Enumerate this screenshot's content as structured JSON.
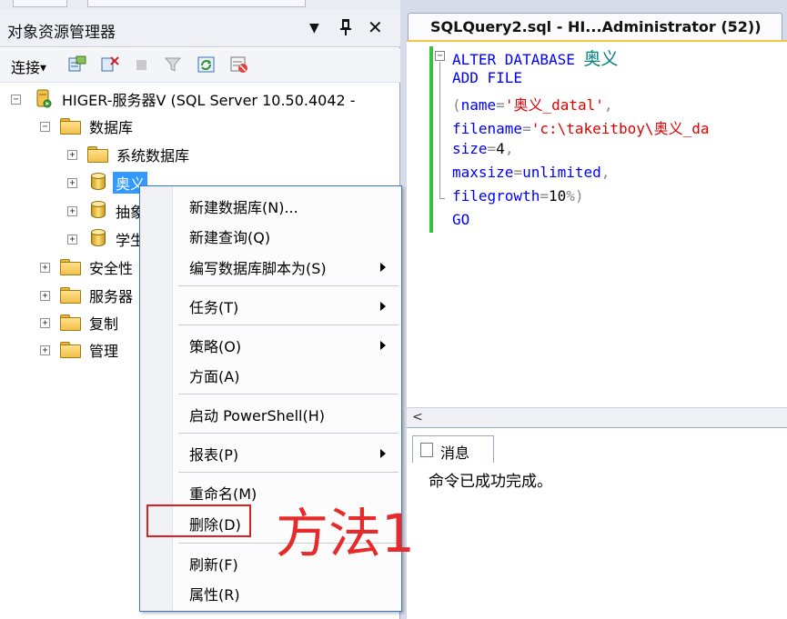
{
  "object_explorer": {
    "title": "对象资源管理器",
    "dropdown_glyph": "▼",
    "pin_glyph": "📌",
    "close_glyph": "✕",
    "connect_label": "连接",
    "tree": {
      "server": "HIGER-服务器V (SQL Server 10.50.4042 -",
      "databases": "数据库",
      "system_databases": "系统数据库",
      "db_aoyi": "奥义",
      "db_2": "抽象",
      "db_3": "学生",
      "security": "安全性",
      "server_objects": "服务器",
      "replication": "复制",
      "management": "管理"
    }
  },
  "editor": {
    "tab_title": "SQLQuery2.sql - HI...Administrator (52))",
    "lines": {
      "l1_kw": "ALTER DATABASE",
      "l1_id": "奥义",
      "l2_kw": "ADD FILE",
      "l3_op": "(",
      "l3_kw": "name",
      "l3_eq": "=",
      "l3_str": "'奥义_datal'",
      "l3_comma": ",",
      "l4_kw": "filename",
      "l4_eq": "=",
      "l4_str": "'c:\\takeitboy\\奥义_da",
      "l5_kw": "size",
      "l5_eq": "=",
      "l5_num": "4",
      "l5_comma": ",",
      "l6_kw": "maxsize",
      "l6_eq": "=",
      "l6_fn": "unlimited",
      "l6_comma": ",",
      "l7_kw": "filegrowth",
      "l7_eq": "=",
      "l7_num": "10",
      "l7_pct": "%)",
      "l8_kw": "GO"
    },
    "results_tab": "消息",
    "results_message": "命令已成功完成。"
  },
  "context_menu": {
    "new_database": "新建数据库(N)...",
    "new_query": "新建查询(Q)",
    "script_as": "编写数据库脚本为(S)",
    "tasks": "任务(T)",
    "policies": "策略(O)",
    "facets": "方面(A)",
    "powershell": "启动 PowerShell(H)",
    "reports": "报表(P)",
    "rename": "重命名(M)",
    "delete": "删除(D)",
    "refresh": "刷新(F)",
    "properties": "属性(R)"
  },
  "annotation": "方法1",
  "colors": {
    "keyword": "#0000ff",
    "string": "#e00000",
    "selection": "#3399ff",
    "annotation": "#e52b2b",
    "change_bar": "#38c13a"
  }
}
